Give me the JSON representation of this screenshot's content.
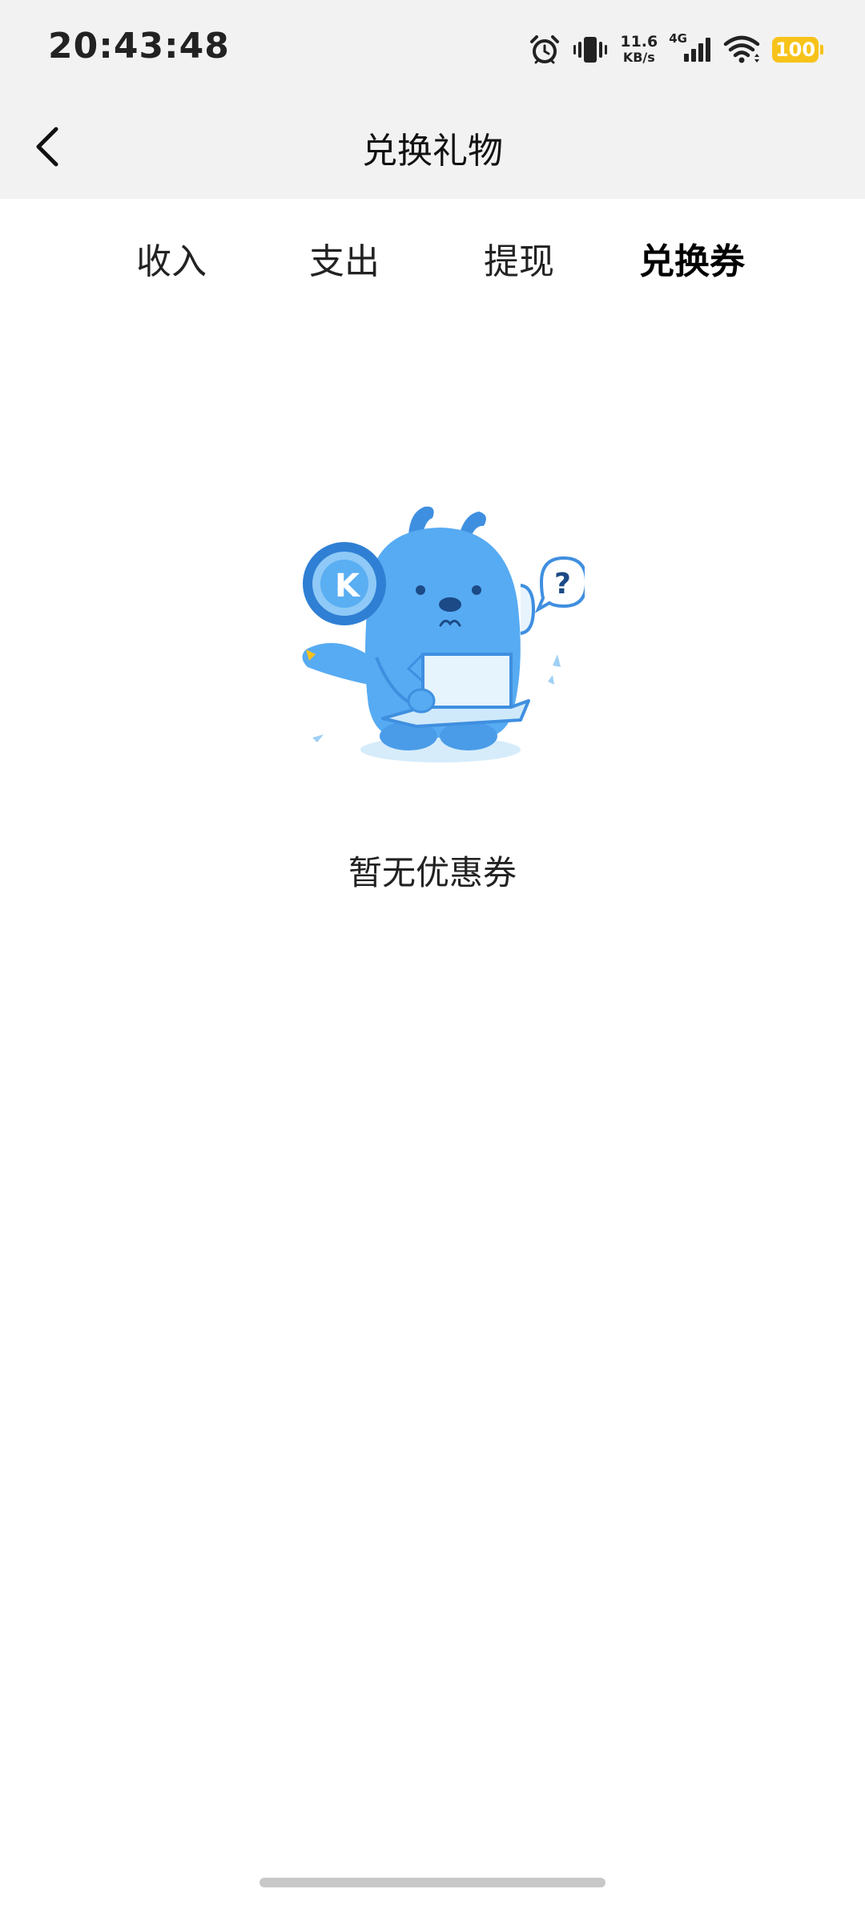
{
  "status_bar": {
    "time": "20:43:48",
    "net_speed_value": "11.6",
    "net_speed_unit": "KB/s",
    "network_type": "4G",
    "battery": "100",
    "icons": [
      "alarm-icon",
      "vibrate-icon",
      "signal-icon",
      "wifi-icon",
      "battery-icon"
    ]
  },
  "header": {
    "title": "兑换礼物",
    "back_icon": "chevron-left-icon"
  },
  "tabs": [
    {
      "label": "收入",
      "active": false
    },
    {
      "label": "支出",
      "active": false
    },
    {
      "label": "提现",
      "active": false
    },
    {
      "label": "兑换券",
      "active": true
    }
  ],
  "empty_state": {
    "illustration": "confused-mascot-with-empty-box",
    "message": "暂无优惠券"
  },
  "colors": {
    "header_bg": "#f2f2f2",
    "accent_underline": "#7ee8ea",
    "mascot_blue": "#4aa3f0",
    "battery": "#f7c31a"
  }
}
